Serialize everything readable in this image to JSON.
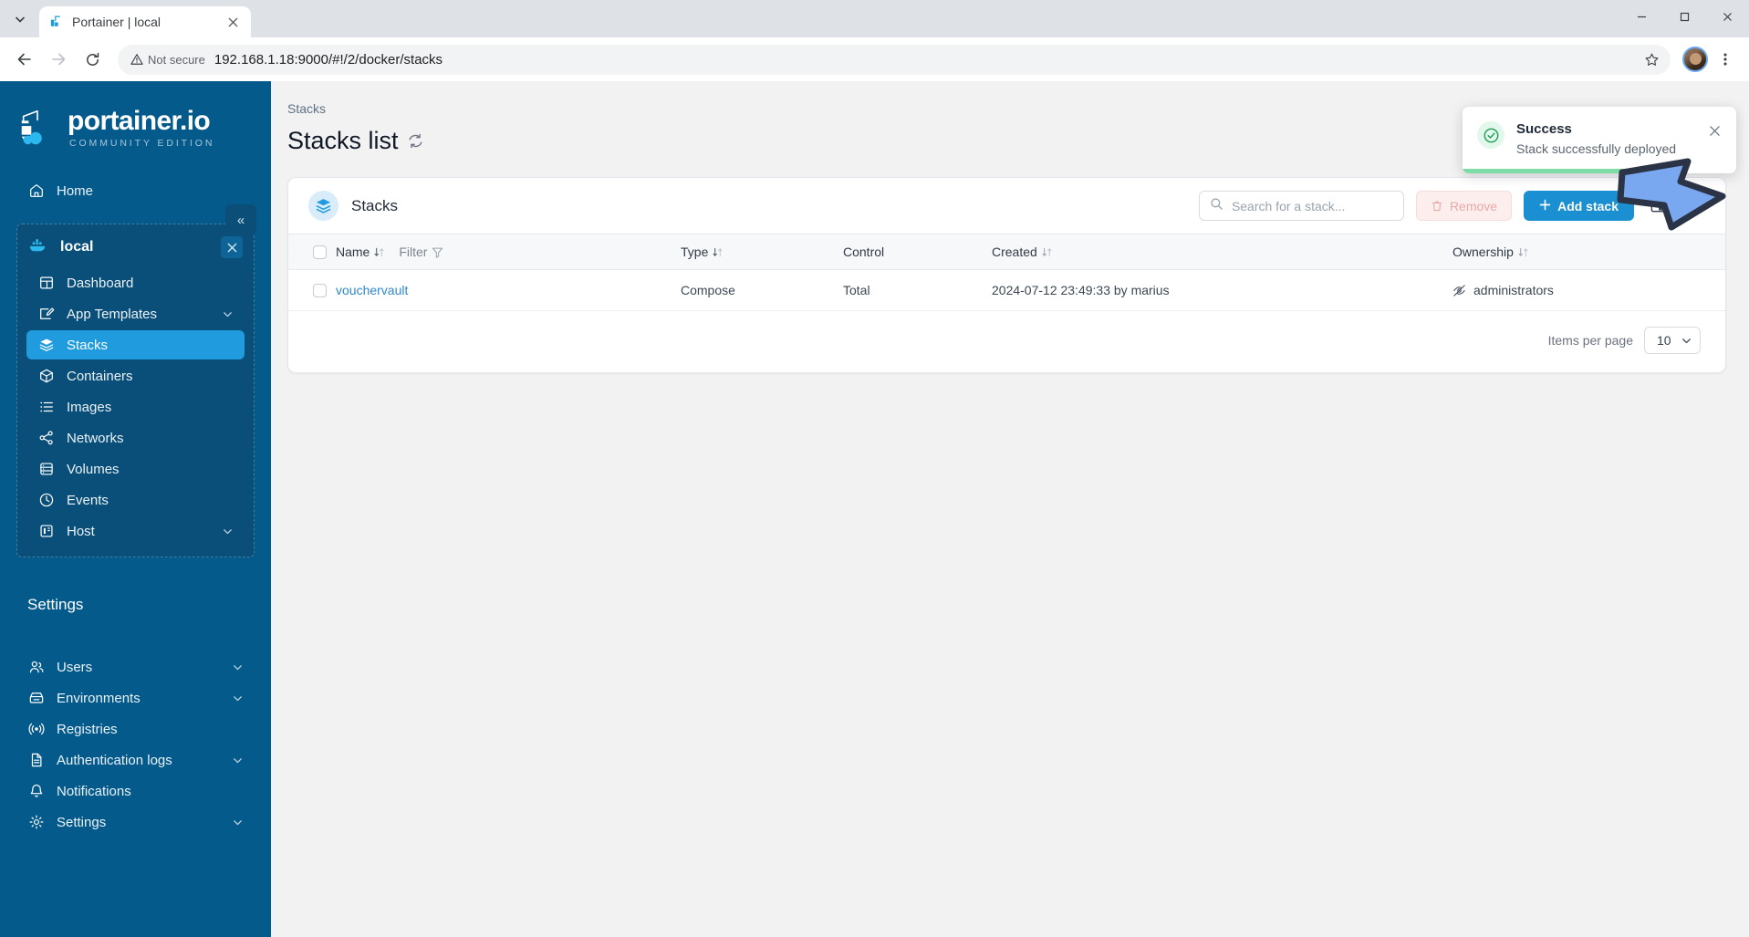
{
  "browser": {
    "tab": {
      "title": "Portainer | local",
      "favicon_icon": "portainer-favicon",
      "close_icon": "close-icon"
    },
    "tab_list_icon": "chevron-down-icon",
    "back_icon": "back-arrow-icon",
    "forward_icon": "forward-arrow-icon",
    "reload_icon": "reload-icon",
    "security_label": "Not secure",
    "security_icon": "warning-triangle-icon",
    "url": "192.168.1.18:9000/#!/2/docker/stacks",
    "star_icon": "bookmark-star-icon",
    "avatar_icon": "profile-avatar",
    "menu_icon": "three-dot-menu-icon",
    "minimize_icon": "minimize-icon",
    "maximize_icon": "maximize-icon",
    "window_close_icon": "window-close-icon"
  },
  "sidebar": {
    "brand_name": "portainer.io",
    "brand_subtitle": "COMMUNITY EDITION",
    "brand_logo_icon": "portainer-crane-logo",
    "collapse_label": "«",
    "home": {
      "label": "Home",
      "icon": "home-icon"
    },
    "environment": {
      "label": "local",
      "icon": "docker-whale-icon",
      "close_icon": "close-icon"
    },
    "env_items": [
      {
        "label": "Dashboard",
        "icon": "dashboard-icon",
        "active": false,
        "chevron": false
      },
      {
        "label": "App Templates",
        "icon": "template-edit-icon",
        "active": false,
        "chevron": true
      },
      {
        "label": "Stacks",
        "icon": "stacks-layers-icon",
        "active": true,
        "chevron": false
      },
      {
        "label": "Containers",
        "icon": "container-box-icon",
        "active": false,
        "chevron": false
      },
      {
        "label": "Images",
        "icon": "images-list-icon",
        "active": false,
        "chevron": false
      },
      {
        "label": "Networks",
        "icon": "network-share-icon",
        "active": false,
        "chevron": false
      },
      {
        "label": "Volumes",
        "icon": "volumes-database-icon",
        "active": false,
        "chevron": false
      },
      {
        "label": "Events",
        "icon": "events-clock-icon",
        "active": false,
        "chevron": false
      },
      {
        "label": "Host",
        "icon": "host-server-icon",
        "active": false,
        "chevron": true
      }
    ],
    "settings_section_title": "Settings",
    "settings_items": [
      {
        "label": "Users",
        "icon": "users-icon",
        "chevron": true
      },
      {
        "label": "Environments",
        "icon": "environments-box-icon",
        "chevron": true
      },
      {
        "label": "Registries",
        "icon": "registries-broadcast-icon",
        "chevron": false
      },
      {
        "label": "Authentication logs",
        "icon": "document-log-icon",
        "chevron": true
      },
      {
        "label": "Notifications",
        "icon": "bell-icon",
        "chevron": false
      },
      {
        "label": "Settings",
        "icon": "gear-icon",
        "chevron": true
      }
    ]
  },
  "main": {
    "breadcrumb": "Stacks",
    "page_title": "Stacks list",
    "refresh_icon": "refresh-icon",
    "card": {
      "icon": "stacks-layers-icon",
      "title": "Stacks",
      "search_placeholder": "Search for a stack...",
      "search_value": "",
      "search_icon": "search-icon",
      "remove_label": "Remove",
      "remove_icon": "trash-icon",
      "add_label": "Add stack",
      "add_icon": "plus-icon",
      "columns_icon": "columns-layout-icon",
      "more_icon": "three-dot-menu-icon"
    },
    "table": {
      "columns": [
        {
          "label": "Name",
          "sortable": true
        },
        {
          "label": "Type",
          "sortable": true
        },
        {
          "label": "Control",
          "sortable": false
        },
        {
          "label": "Created",
          "sortable": true
        },
        {
          "label": "Ownership",
          "sortable": true
        }
      ],
      "filter_label": "Filter",
      "filter_icon": "funnel-icon",
      "rows": [
        {
          "name": "vouchervault",
          "type": "Compose",
          "control": "Total",
          "created": "2024-07-12 23:49:33 by marius",
          "ownership": "administrators",
          "ownership_icon": "eye-off-icon"
        }
      ]
    },
    "pagination": {
      "label": "Items per page",
      "value": "10",
      "chevron_icon": "chevron-down-icon"
    }
  },
  "toast": {
    "title": "Success",
    "message": "Stack successfully deployed",
    "icon": "check-circle-icon",
    "close_icon": "close-icon",
    "progress_color": "#7fdca6"
  },
  "annotation": {
    "arrow_icon": "pointer-arrow-icon",
    "fill": "#7aa8f0",
    "stroke": "#2b3446"
  }
}
